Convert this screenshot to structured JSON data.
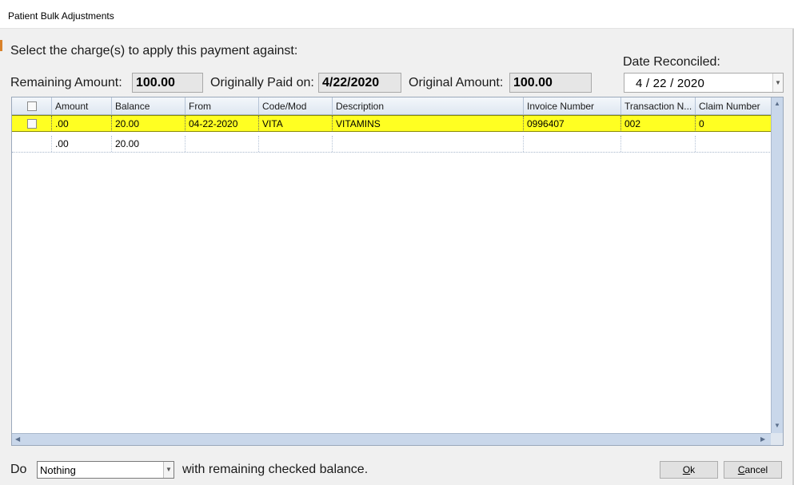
{
  "window": {
    "title": "Patient Bulk Adjustments"
  },
  "instruction": "Select the charge(s) to apply this payment against:",
  "summary": {
    "remaining_label": "Remaining Amount:",
    "remaining_value": "100.00",
    "originally_paid_label": "Originally Paid on:",
    "originally_paid_value": "4/22/2020",
    "original_amount_label": "Original Amount:",
    "original_amount_value": "100.00"
  },
  "date_reconciled": {
    "label": "Date Reconciled:",
    "value": "4  /  22  /  2020"
  },
  "grid": {
    "columns": [
      "Amount",
      "Balance",
      "From",
      "Code/Mod",
      "Description",
      "Invoice Number",
      "Transaction  N...",
      "Claim Number"
    ],
    "rows": [
      {
        "amount": ".00",
        "balance": "20.00",
        "from": "04-22-2020",
        "code_mod": "VITA",
        "description": "VITAMINS",
        "invoice_number": "0996407",
        "transaction_number": "002",
        "claim_number": "0",
        "selected": true,
        "checked": false
      }
    ],
    "totals": {
      "amount": ".00",
      "balance": "20.00"
    }
  },
  "footer": {
    "do_label": "Do",
    "action_value": "Nothing",
    "suffix": "with remaining checked balance.",
    "ok_hotkey": "O",
    "ok_rest": "k",
    "cancel_hotkey": "C",
    "cancel_rest": "ancel"
  },
  "colors": {
    "selected_row": "#ffff22",
    "header_bg": "#dfe7f1",
    "scrollbar": "#c9d7ea"
  }
}
